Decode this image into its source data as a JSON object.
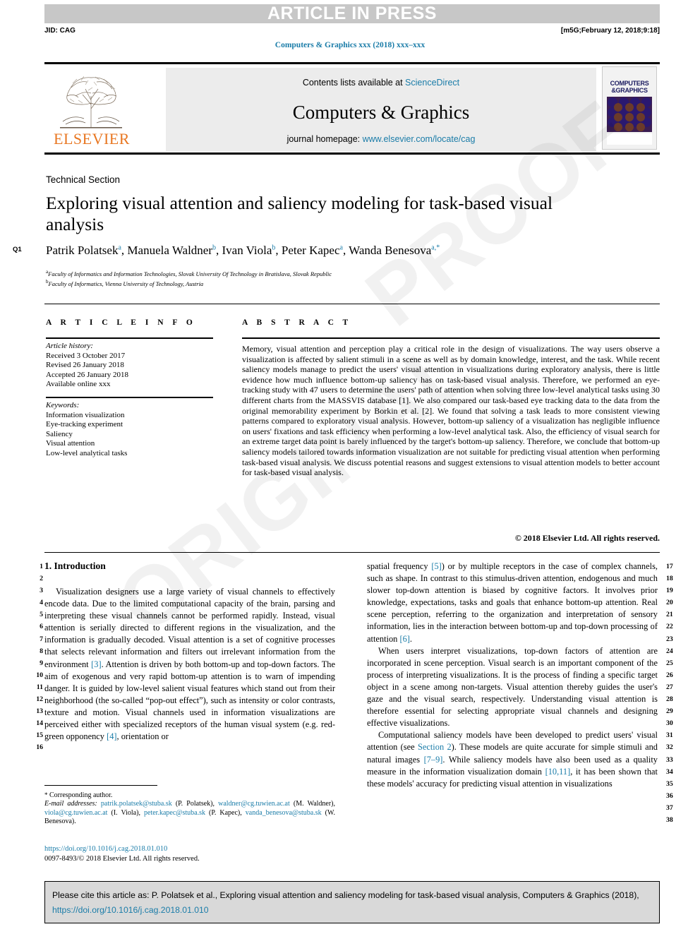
{
  "header": {
    "article_in_press": "ARTICLE IN PRESS",
    "jid": "JID: CAG",
    "build_stamp": "[m5G;February 12, 2018;9:18]",
    "journal_ref": "Computers & Graphics xxx (2018) xxx–xxx"
  },
  "masthead": {
    "contents_prefix": "Contents lists available at ",
    "sciencedirect": "ScienceDirect",
    "journal_title": "Computers & Graphics",
    "homepage_prefix": "journal homepage: ",
    "homepage_url": "www.elsevier.com/locate/cag",
    "publisher": "ELSEVIER",
    "cover_title_line1": "COMPUTERS",
    "cover_title_line2": "&GRAPHICS"
  },
  "article": {
    "section_label": "Technical Section",
    "title": "Exploring visual attention and saliency modeling for task-based visual analysis",
    "query_marker": "Q1",
    "authors": [
      {
        "name": "Patrik Polatsek",
        "sup": "a",
        "sep": ", "
      },
      {
        "name": "Manuela Waldner",
        "sup": "b",
        "sep": ", "
      },
      {
        "name": "Ivan Viola",
        "sup": "b",
        "sep": ", "
      },
      {
        "name": "Peter Kapec",
        "sup": "a",
        "sep": ", "
      },
      {
        "name": "Wanda Benesova",
        "sup": "a,*",
        "sep": ""
      }
    ],
    "affiliations": [
      {
        "sup": "a",
        "text": "Faculty of Informatics and Information Technologies, Slovak University Of Technology in Bratislava, Slovak Republic"
      },
      {
        "sup": "b",
        "text": "Faculty of Informatics, Vienna University of Technology, Austria"
      }
    ]
  },
  "article_info": {
    "heading": "A R T I C L E    I N F O",
    "history_label": "Article history:",
    "history": [
      "Received 3 October 2017",
      "Revised 26 January 2018",
      "Accepted 26 January 2018",
      "Available online xxx"
    ],
    "keywords_label": "Keywords:",
    "keywords": [
      "Information visualization",
      "Eye-tracking experiment",
      "Saliency",
      "Visual attention",
      "Low-level analytical tasks"
    ]
  },
  "abstract": {
    "heading": "A B S T R A C T",
    "text": "Memory, visual attention and perception play a critical role in the design of visualizations. The way users observe a visualization is affected by salient stimuli in a scene as well as by domain knowledge, interest, and the task. While recent saliency models manage to predict the users' visual attention in visualizations during exploratory analysis, there is little evidence how much influence bottom-up saliency has on task-based visual analysis. Therefore, we performed an eye-tracking study with 47 users to determine the users' path of attention when solving three low-level analytical tasks using 30 different charts from the MASSVIS database [1]. We also compared our task-based eye tracking data to the data from the original memorability experiment by Borkin et al. [2]. We found that solving a task leads to more consistent viewing patterns compared to exploratory visual analysis. However, bottom-up saliency of a visualization has negligible influence on users' fixations and task efficiency when performing a low-level analytical task. Also, the efficiency of visual search for an extreme target data point is barely influenced by the target's bottom-up saliency. Therefore, we conclude that bottom-up saliency models tailored towards information visualization are not suitable for predicting visual attention when performing task-based visual analysis. We discuss potential reasons and suggest extensions to visual attention models to better account for task-based visual analysis.",
    "copyright": "© 2018 Elsevier Ltd. All rights reserved."
  },
  "body": {
    "section_heading": "1. Introduction",
    "left_paragraph_1": "Visualization designers use a large variety of visual channels to effectively encode data. Due to the limited computational capacity of the brain, parsing and interpreting these visual channels cannot be performed rapidly. Instead, visual attention is serially directed to different regions in the visualization, and the information is gradually decoded. Visual attention is a set of cognitive processes that selects relevant information and filters out irrelevant information from the environment [3]. Attention is driven by both bottom-up and top-down factors. The aim of exogenous and very rapid bottom-up attention is to warn of impending danger. It is guided by low-level salient visual features which stand out from their neighborhood (the so-called “pop-out effect”), such as intensity or color contrasts, texture and motion. Visual channels used in information visualizations are perceived either with specialized receptors of the human visual system (e.g. red-green opponency [4], orientation or",
    "right_paragraph_1": "spatial frequency [5]) or by multiple receptors in the case of complex channels, such as shape. In contrast to this stimulus-driven attention, endogenous and much slower top-down attention is biased by cognitive factors. It involves prior knowledge, expectations, tasks and goals that enhance bottom-up attention. Real scene perception, referring to the organization and interpretation of sensory information, lies in the interaction between bottom-up and top-down processing of attention [6].",
    "right_paragraph_2": "When users interpret visualizations, top-down factors of attention are incorporated in scene perception. Visual search is an important component of the process of interpreting visualizations. It is the process of finding a specific target object in a scene among non-targets. Visual attention thereby guides the user's gaze and the visual search, respectively. Understanding visual attention is therefore essential for selecting appropriate visual channels and designing effective visualizations.",
    "right_paragraph_3": "Computational saliency models have been developed to predict users' visual attention (see Section 2). These models are quite accurate for simple stimuli and natural images [7–9]. While saliency models have also been used as a quality measure in the information visualization domain [10,11], it has been shown that these models' accuracy for predicting visual attention in visualizations",
    "line_numbers_left": [
      "1",
      "2",
      "3",
      "4",
      "5",
      "6",
      "7",
      "8",
      "9",
      "10",
      "11",
      "12",
      "13",
      "14",
      "15",
      "16"
    ],
    "line_numbers_right": [
      "17",
      "18",
      "19",
      "20",
      "21",
      "22",
      "23",
      "24",
      "25",
      "26",
      "27",
      "28",
      "29",
      "30",
      "31",
      "32",
      "33",
      "34",
      "35",
      "36",
      "37",
      "38"
    ],
    "inline_refs": {
      "r3": "[3]",
      "r4": "[4]",
      "r5": "[5]",
      "r6": "[6]",
      "section2": "Section 2",
      "r79": "[7–9]",
      "r1011": "[10,11]"
    }
  },
  "footnote": {
    "corresponding_marker": "*",
    "corresponding": "Corresponding author.",
    "email_label": "E-mail addresses:",
    "emails": [
      {
        "address": "patrik.polatsek@stuba.sk",
        "person": "(P. Polatsek), "
      },
      {
        "address": "waldner@cg.tuwien.ac.at",
        "person": " (M. Waldner), "
      },
      {
        "address": "viola@cg.tuwien.ac.at",
        "person": " (I. Viola), "
      },
      {
        "address": "peter.kapec@stuba.sk",
        "person": " (P. Kapec), "
      },
      {
        "address": "vanda_benesova@stuba.sk",
        "person": " (W. Benesova)."
      }
    ],
    "doi": "https://doi.org/10.1016/j.cag.2018.01.010",
    "issn_line": "0097-8493/© 2018 Elsevier Ltd. All rights reserved."
  },
  "cite_box": {
    "prefix": "Please cite this article as: P. Polatsek et al., Exploring visual attention and saliency modeling for task-based visual analysis, Computers & Graphics (2018), ",
    "doi": "https://doi.org/10.1016/j.cag.2018.01.010"
  },
  "watermark": {
    "line1": "ORIGINAL",
    "line2": "PROOF"
  },
  "colors": {
    "link": "#1a7ca8",
    "elsevier_orange": "#e87722",
    "band_gray": "#c7c7c7",
    "panel_gray": "#ececec",
    "cite_gray": "#d9d9d9"
  }
}
